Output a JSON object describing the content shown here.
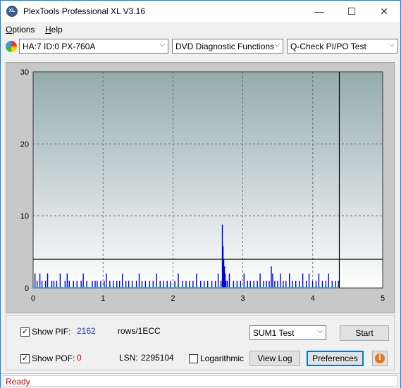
{
  "window": {
    "title": "PlexTools Professional XL V3.16",
    "app_icon_text": "XL",
    "controls": {
      "minimize": "—",
      "maximize": "☐",
      "close": "✕"
    }
  },
  "menu": {
    "options": {
      "prefix": "O",
      "rest": "ptions"
    },
    "help": {
      "prefix": "H",
      "rest": "elp"
    }
  },
  "toolbar": {
    "drive": "HA:7 ID:0  PX-760A",
    "function": "DVD Diagnostic Functions",
    "test": "Q-Check PI/PO Test"
  },
  "chart_data": {
    "type": "bar",
    "xlim": [
      0,
      5
    ],
    "ylim": [
      0,
      30
    ],
    "x_ticks": [
      "0",
      "1",
      "2",
      "3",
      "4",
      "5"
    ],
    "y_ticks": [
      "0",
      "10",
      "20",
      "30"
    ],
    "threshold": 4,
    "end_marker_x": 4.38,
    "grid": true,
    "series": [
      {
        "color": "#0000dd",
        "x": [
          0.02,
          0.05,
          0.09,
          0.12,
          0.17,
          0.2,
          0.26,
          0.29,
          0.33,
          0.38,
          0.45,
          0.48,
          0.51,
          0.57,
          0.62,
          0.68,
          0.71,
          0.76,
          0.84,
          0.88,
          0.91,
          0.96,
          1.01,
          1.04,
          1.09,
          1.14,
          1.19,
          1.23,
          1.27,
          1.32,
          1.36,
          1.41,
          1.47,
          1.51,
          1.55,
          1.6,
          1.66,
          1.71,
          1.76,
          1.81,
          1.86,
          1.91,
          1.96,
          2.02,
          2.07,
          2.13,
          2.18,
          2.23,
          2.28,
          2.33,
          2.39,
          2.44,
          2.49,
          2.55,
          2.6,
          2.64,
          2.68,
          2.7,
          2.71,
          2.72,
          2.73,
          2.74,
          2.75,
          2.77,
          2.8,
          2.86,
          2.91,
          2.96,
          3.01,
          3.06,
          3.1,
          3.15,
          3.2,
          3.24,
          3.29,
          3.33,
          3.37,
          3.4,
          3.42,
          3.45,
          3.49,
          3.53,
          3.57,
          3.61,
          3.66,
          3.7,
          3.75,
          3.8,
          3.85,
          3.9,
          3.94,
          3.99,
          4.04,
          4.08,
          4.13,
          4.18,
          4.22,
          4.27,
          4.32,
          4.36
        ],
        "y": [
          2,
          1,
          2,
          1,
          1,
          2,
          1,
          1,
          1,
          2,
          1,
          2,
          1,
          1,
          1,
          1,
          2,
          1,
          1,
          1,
          1,
          1,
          1,
          2,
          1,
          1,
          1,
          1,
          2,
          1,
          1,
          1,
          1,
          2,
          1,
          1,
          1,
          1,
          2,
          1,
          1,
          1,
          1,
          1,
          2,
          1,
          1,
          1,
          1,
          2,
          1,
          1,
          1,
          1,
          1,
          2,
          1,
          8.8,
          5.8,
          4,
          3,
          2,
          1,
          1,
          2,
          1,
          1,
          1,
          2,
          1,
          1,
          1,
          1,
          2,
          1,
          1,
          1,
          3,
          2,
          1,
          1,
          2,
          1,
          1,
          2,
          1,
          1,
          1,
          2,
          1,
          2,
          1,
          1,
          2,
          1,
          1,
          2,
          1,
          1,
          1
        ]
      }
    ]
  },
  "controls": {
    "show_pif_label": "Show PIF:",
    "show_pif_checked": true,
    "pif_value": "2162",
    "pif_unit": "rows/1ECC",
    "show_pof_label": "Show POF:",
    "show_pof_checked": true,
    "pof_value": "0",
    "lsn_label": "LSN:",
    "lsn_value": "2295104",
    "logarithmic_label": "Logarithmic",
    "logarithmic_checked": false,
    "sum_select": "SUM1 Test",
    "start_label": "Start",
    "view_log_label": "View Log",
    "preferences_label": "Preferences",
    "info_icon_text": "i",
    "checkmark": "✓"
  },
  "status": {
    "text": "Ready"
  }
}
